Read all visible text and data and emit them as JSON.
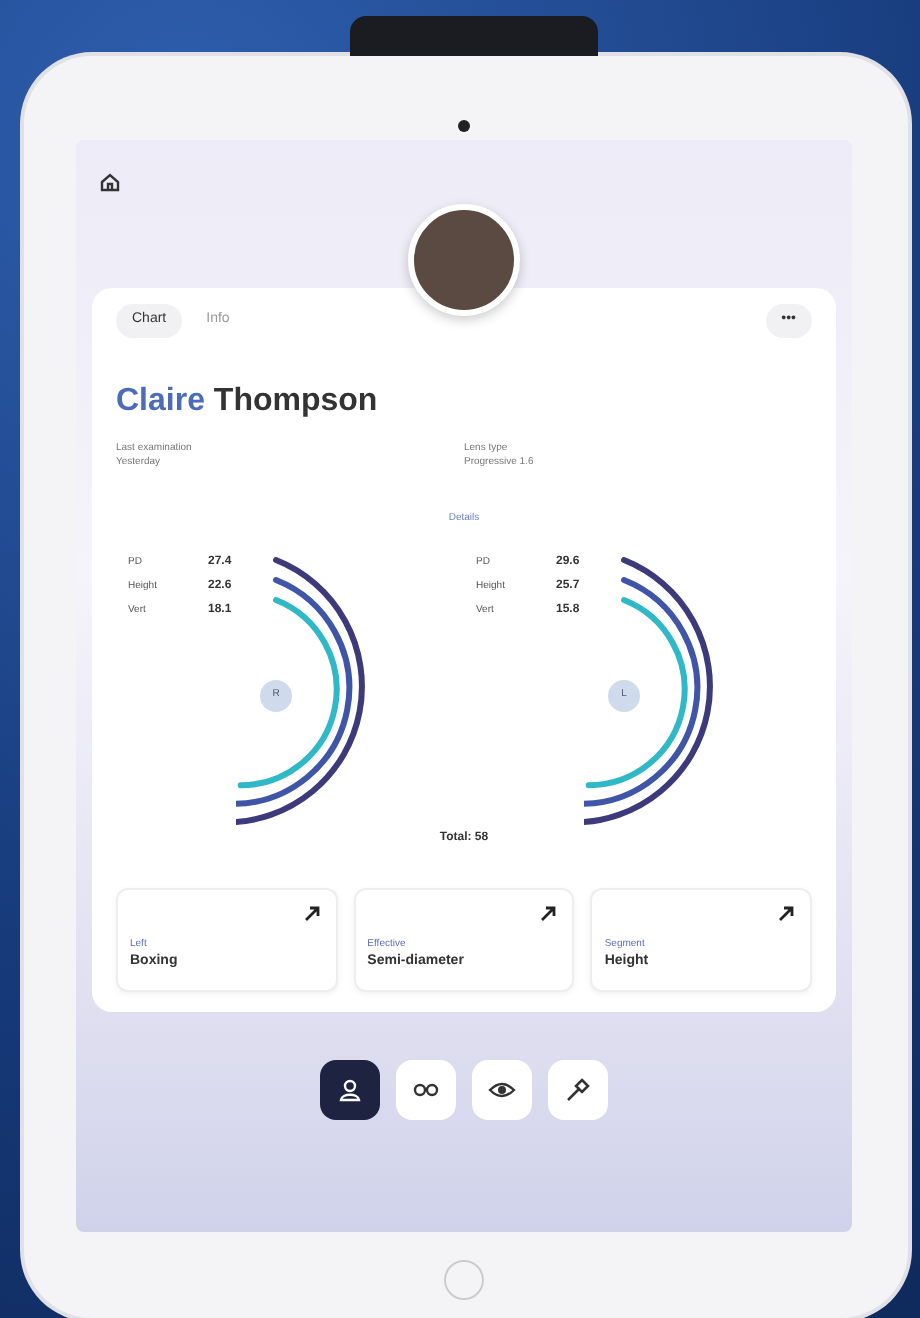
{
  "header": {
    "tabs": [
      {
        "label": "Chart",
        "selected": true
      },
      {
        "label": "Info",
        "selected": false
      }
    ],
    "more": "•••"
  },
  "patient": {
    "first_name": "Claire",
    "last_name": "Thompson",
    "details": [
      {
        "label": "Last examination",
        "value": "Yesterday"
      },
      {
        "label": "Lens type",
        "value": "Progressive 1.6"
      }
    ]
  },
  "divider_label": "Details",
  "eyes": [
    {
      "center": "R",
      "rows": [
        {
          "label": "PD",
          "value": "27.4"
        },
        {
          "label": "Height",
          "value": "22.6"
        },
        {
          "label": "Vert",
          "value": "18.1"
        }
      ]
    },
    {
      "center": "L",
      "rows": [
        {
          "label": "PD",
          "value": "29.6"
        },
        {
          "label": "Height",
          "value": "25.7"
        },
        {
          "label": "Vert",
          "value": "15.8"
        }
      ]
    }
  ],
  "total": "Total: 58",
  "cards": [
    {
      "label": "Left",
      "value": "Boxing"
    },
    {
      "label": "Effective",
      "value": "Semi-diameter"
    },
    {
      "label": "Segment",
      "value": "Height"
    }
  ],
  "nav": [
    {
      "kind": "person",
      "selected": true
    },
    {
      "kind": "glasses",
      "selected": false
    },
    {
      "kind": "eye",
      "selected": false
    },
    {
      "kind": "tools",
      "selected": false
    }
  ]
}
